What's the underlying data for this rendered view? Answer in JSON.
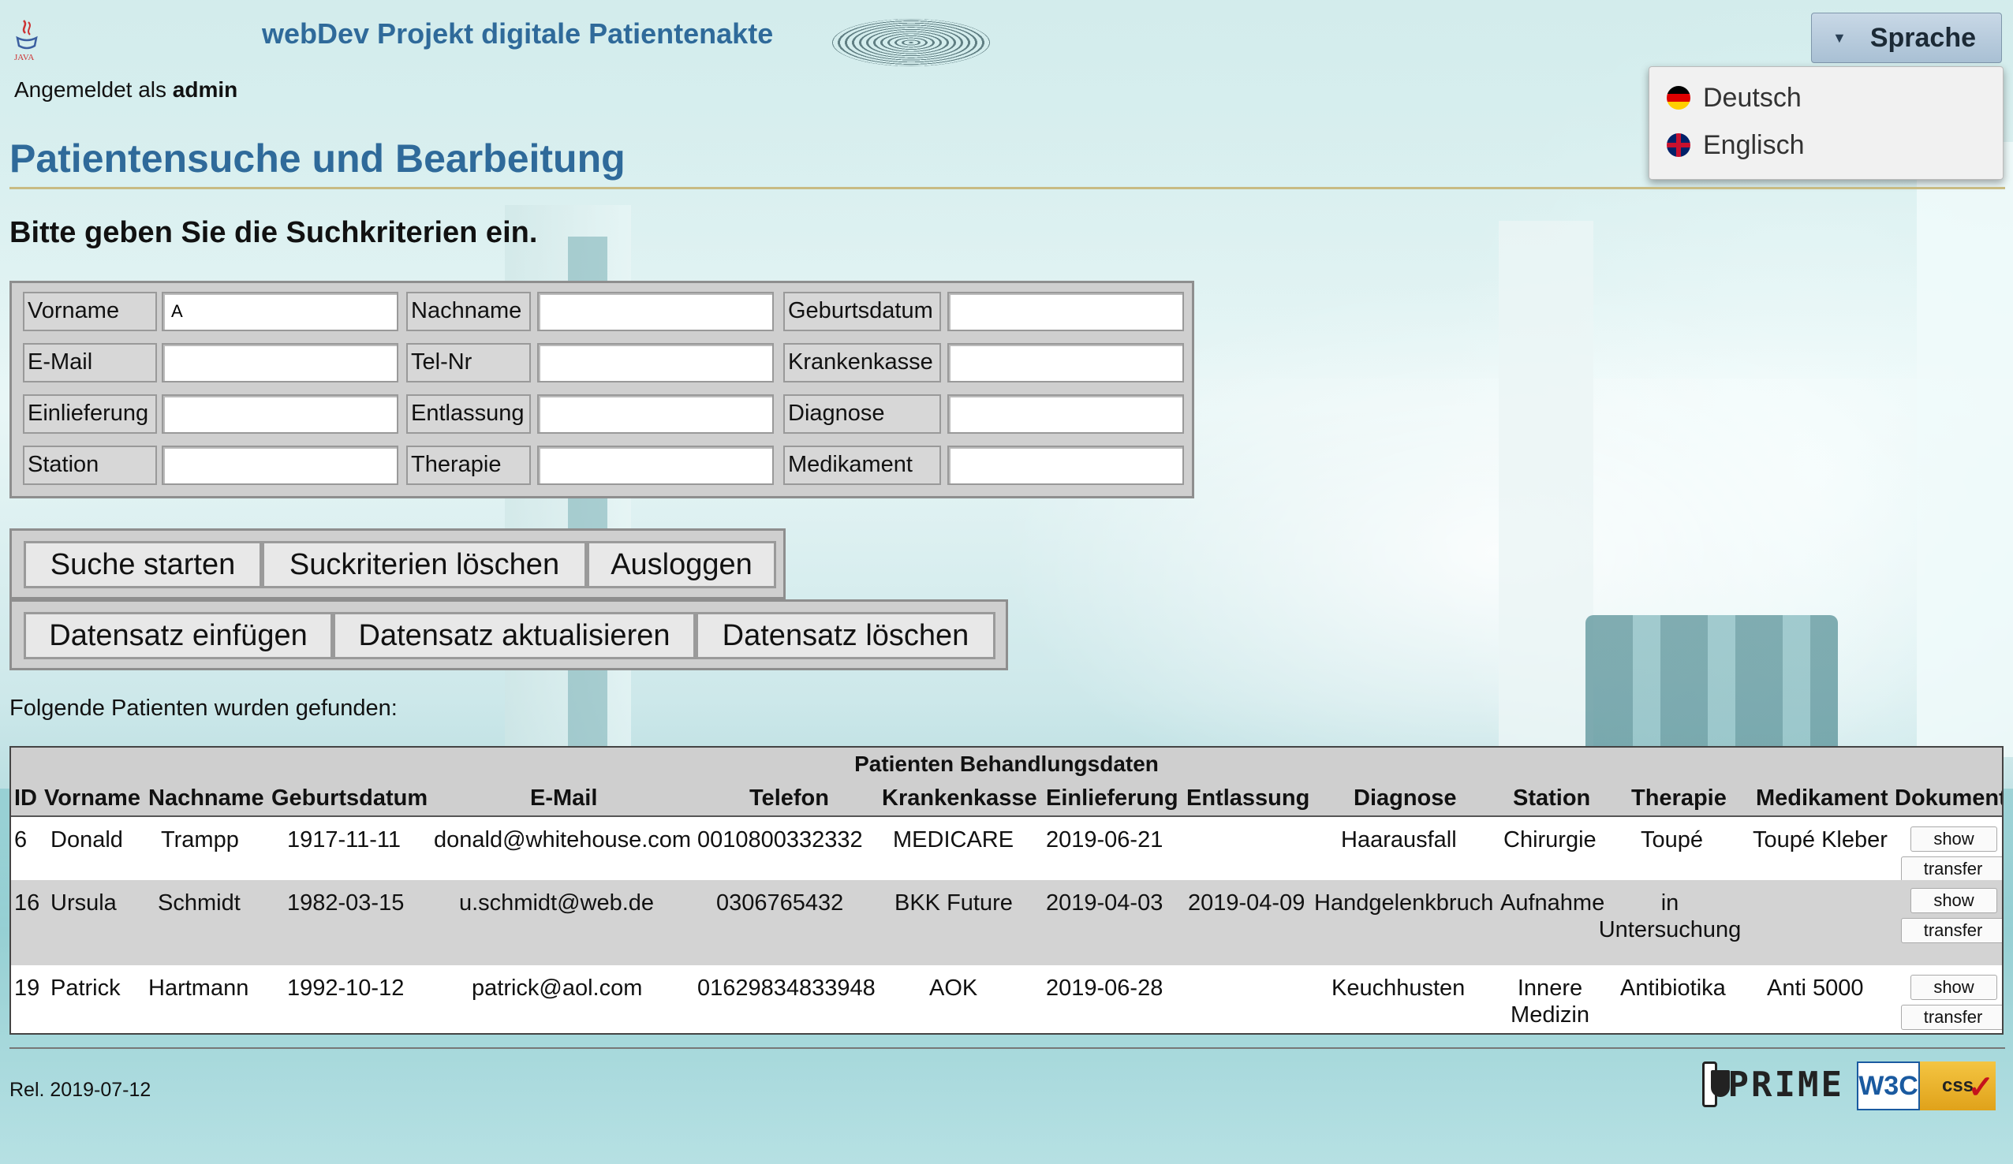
{
  "header": {
    "app_title": "webDev Projekt digitale Patientenakte",
    "logged_in_prefix": "Angemeldet als",
    "logged_in_user": "admin",
    "logo_icon": "java-logo"
  },
  "language": {
    "button_label": "Sprache",
    "menu_open": true,
    "options": [
      {
        "label": "Deutsch",
        "icon": "german-flag-icon"
      },
      {
        "label": "Englisch",
        "icon": "uk-flag-icon"
      }
    ]
  },
  "page": {
    "heading": "Patientensuche und Bearbeitung",
    "prompt": "Bitte geben Sie die Suchkriterien ein."
  },
  "search_form": {
    "fields": [
      {
        "label": "Vorname",
        "value": "A"
      },
      {
        "label": "Nachname",
        "value": ""
      },
      {
        "label": "Geburtsdatum",
        "value": ""
      },
      {
        "label": "E-Mail",
        "value": ""
      },
      {
        "label": "Tel-Nr",
        "value": ""
      },
      {
        "label": "Krankenkasse",
        "value": ""
      },
      {
        "label": "Einlieferung",
        "value": ""
      },
      {
        "label": "Entlassung",
        "value": ""
      },
      {
        "label": "Diagnose",
        "value": ""
      },
      {
        "label": "Station",
        "value": ""
      },
      {
        "label": "Therapie",
        "value": ""
      },
      {
        "label": "Medikament",
        "value": ""
      }
    ]
  },
  "actions": {
    "search": "Suche starten",
    "clear": "Suckriterien löschen",
    "logout": "Ausloggen",
    "insert": "Datensatz einfügen",
    "update": "Datensatz aktualisieren",
    "delete": "Datensatz löschen"
  },
  "results": {
    "found_text": "Folgende Patienten wurden gefunden:",
    "caption": "Patienten Behandlungsdaten",
    "columns": [
      "ID",
      "Vorname",
      "Nachname",
      "Geburtsdatum",
      "E-Mail",
      "Telefon",
      "Krankenkasse",
      "Einlieferung",
      "Entlassung",
      "Diagnose",
      "Station",
      "Therapie",
      "Medikament",
      "Dokument"
    ],
    "show_label": "show",
    "transfer_label": "transfer",
    "rows": [
      {
        "id": "6",
        "vorname": "Donald",
        "nachname": "Trampp",
        "geburtsdatum": "1917-11-11",
        "email": "donald@whitehouse.com",
        "telefon": "0010800332332",
        "krankenkasse": "MEDICARE",
        "einlieferung": "2019-06-21",
        "entlassung": "",
        "diagnose": "Haarausfall",
        "station": [
          "Chirurgie"
        ],
        "therapie": [
          "Toupé"
        ],
        "medikament": "Toupé Kleber"
      },
      {
        "id": "16",
        "vorname": "Ursula",
        "nachname": "Schmidt",
        "geburtsdatum": "1982-03-15",
        "email": "u.schmidt@web.de",
        "telefon": "0306765432",
        "krankenkasse": "BKK Future",
        "einlieferung": "2019-04-03",
        "entlassung": "2019-04-09",
        "diagnose": "Handgelenkbruch",
        "station": [
          "Aufnahme"
        ],
        "therapie": [
          "in",
          "Untersuchung"
        ],
        "medikament": ""
      },
      {
        "id": "19",
        "vorname": "Patrick",
        "nachname": "Hartmann",
        "geburtsdatum": "1992-10-12",
        "email": "patrick@aol.com",
        "telefon": "01629834833948",
        "krankenkasse": "AOK",
        "einlieferung": "2019-06-28",
        "entlassung": "",
        "diagnose": "Keuchhusten",
        "station": [
          "Innere",
          "Medizin"
        ],
        "therapie": [
          "Antibiotika"
        ],
        "medikament": "Anti 5000"
      }
    ]
  },
  "footer": {
    "release": "Rel. 2019-07-12",
    "prime_logo_text": "PRIME",
    "w3c_logo_text": "W3C",
    "css_logo_text": "css"
  }
}
